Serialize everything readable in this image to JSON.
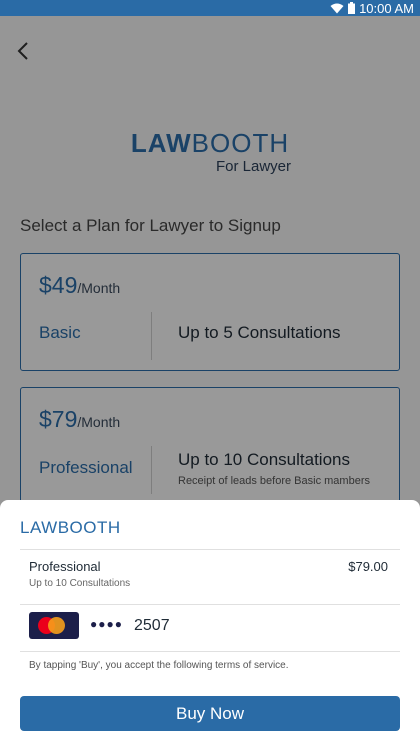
{
  "status_bar": {
    "time": "10:00 AM",
    "icons": [
      "wifi-icon",
      "battery-icon"
    ],
    "color": "#2a6ba6"
  },
  "header": {
    "back_icon": "back-arrow-icon"
  },
  "logo": {
    "bold": "LAW",
    "light": "BOOTH",
    "subtitle": "For Lawyer"
  },
  "heading": "Select a Plan for Lawyer to Signup",
  "plans": [
    {
      "price": "$49",
      "period": "/Month",
      "name": "Basic",
      "description": "Up to 5 Consultations",
      "note": ""
    },
    {
      "price": "$79",
      "period": "/Month",
      "name": "Professional",
      "description": "Up to 10 Consultations",
      "note": "Receipt of leads before Basic mambers"
    }
  ],
  "sheet": {
    "title": "LAWBOOTH",
    "item_name": "Professional",
    "item_sub": "Up to 10 Consultations",
    "item_price": "$79.00",
    "card_icon": "mastercard-icon",
    "card_dots": "●●●●",
    "card_last4": "2507",
    "terms": "By tapping 'Buy', you accept the following terms of service.",
    "buy_label": "Buy Now"
  },
  "colors": {
    "accent": "#2a6ba6",
    "card_bg": "#1c1f4a"
  }
}
